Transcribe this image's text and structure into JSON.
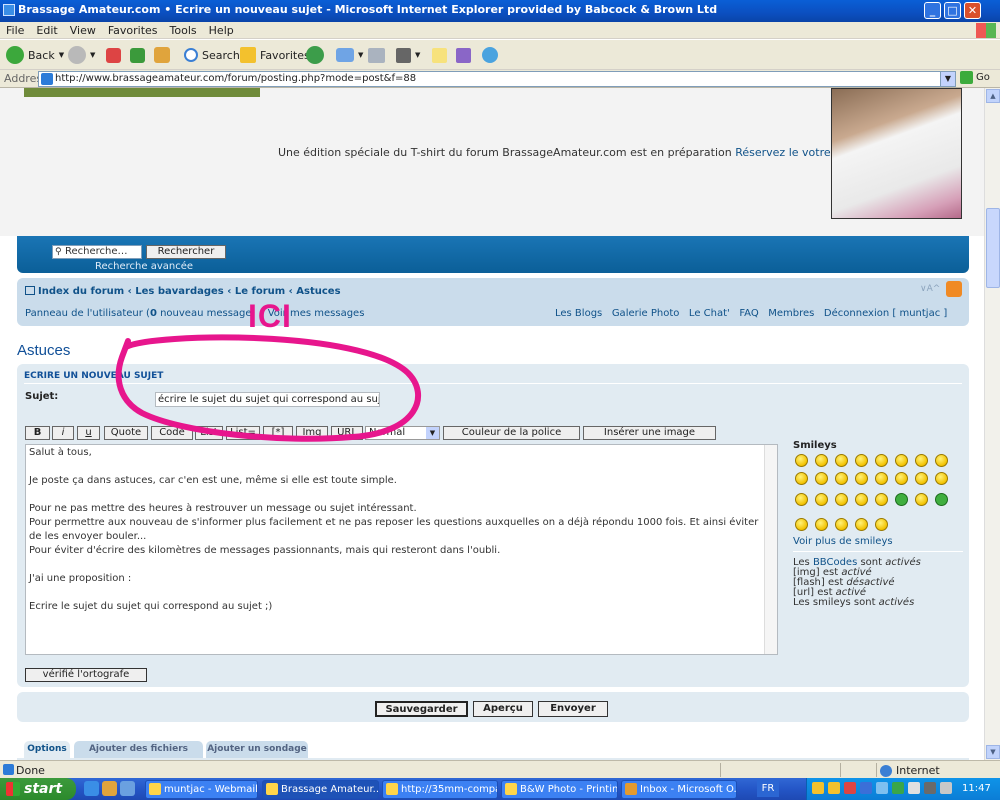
{
  "window": {
    "title": "Brassage Amateur.com • Ecrire un nouveau sujet - Microsoft Internet Explorer provided by Babcock & Brown Ltd",
    "controls": [
      "_",
      "□",
      "✕"
    ]
  },
  "menu": [
    "File",
    "Edit",
    "View",
    "Favorites",
    "Tools",
    "Help"
  ],
  "toolbar": {
    "back": "Back",
    "search": "Search",
    "favorites": "Favorites"
  },
  "address": {
    "label": "Address",
    "url": "http://www.brassageamateur.com/forum/posting.php?mode=post&f=88",
    "go": "Go"
  },
  "promo": {
    "text": "Une édition spéciale du T-shirt du forum BrassageAmateur.com est en préparation",
    "link": "Réservez le votre ici ! >>>"
  },
  "search": {
    "placeholder": "Recherche…",
    "button": "Rechercher",
    "advanced": "Recherche avancée"
  },
  "breadcrumbs": [
    "Index du forum",
    "Les bavardages",
    "Le forum",
    "Astuces"
  ],
  "breadcrumb_sep": "‹",
  "fontsize": "∨A^",
  "usernav": {
    "control_panel": "Panneau de l'utilisateur",
    "count": "0",
    "new_msg": "nouveau message",
    "view_msgs": "Voir mes messages"
  },
  "rightnav": [
    "Les Blogs",
    "Galerie Photo",
    "Le Chat'",
    "FAQ",
    "Membres",
    "Déconnexion [ muntjac ]"
  ],
  "page_title": "Astuces",
  "form": {
    "heading": "Ecrire un nouveau sujet",
    "subject_label": "Sujet:",
    "subject_value": "écrire le sujet du sujet qui correspond au sujet ;)",
    "format_buttons": [
      "B",
      "i",
      "u",
      "Quote",
      "Code",
      "List",
      "List=",
      "[*]",
      "Img",
      "URL"
    ],
    "size_select": "Normal",
    "color_button": "Couleur de la police",
    "image_button": "Insérer une image",
    "message_lines": [
      "Salut à tous,",
      "",
      "Je poste ça dans astuces, car c'en est une, même si elle est toute simple.",
      "",
      "Pour ne pas mettre des heures à restrouver un message ou sujet intéressant.",
      "Pour permettre aux nouveau de s'informer plus facilement et ne pas reposer les questions auxquelles on a déjà répondu 1000 fois. Et ainsi éviter de les envoyer bouler...",
      "Pour éviter d'écrire des kilomètres de messages passionnants, mais qui resteront dans l'oubli.",
      "",
      "J'ai une proposition :",
      "",
      "Ecrire le sujet du sujet qui correspond au sujet ;)"
    ],
    "spell_button": "vérifié l'ortografe"
  },
  "smileys": {
    "heading": "Smileys",
    "more": "Voir plus de smileys",
    "bbcode": [
      {
        "pre": "Les ",
        "link": "BBCodes",
        "post": " sont ",
        "state": "activés"
      },
      {
        "pre": "[img] est ",
        "state": "activé"
      },
      {
        "pre": "[flash] est ",
        "state": "désactivé"
      },
      {
        "pre": "[url] est ",
        "state": "activé"
      },
      {
        "pre": "Les smileys sont ",
        "state": "activés"
      }
    ]
  },
  "actions": {
    "save": "Sauvegarder",
    "preview": "Aperçu",
    "submit": "Envoyer"
  },
  "tabs": [
    "Options",
    "Ajouter des fichiers joints",
    "Ajouter un sondage"
  ],
  "annotation": "ICI",
  "status": {
    "text": "Done",
    "zone": "Internet"
  },
  "taskbar": {
    "start": "start",
    "tasks": [
      "muntjac - Webmail ...",
      "Brassage Amateur....",
      "http://35mm-compa...",
      "B&W Photo - Printin...",
      "Inbox - Microsoft O..."
    ],
    "lang": "FR",
    "clock": "11:47"
  },
  "colors": {
    "accent": "#105289",
    "annotation": "#e7168d",
    "panel": "#e1ebf2"
  }
}
